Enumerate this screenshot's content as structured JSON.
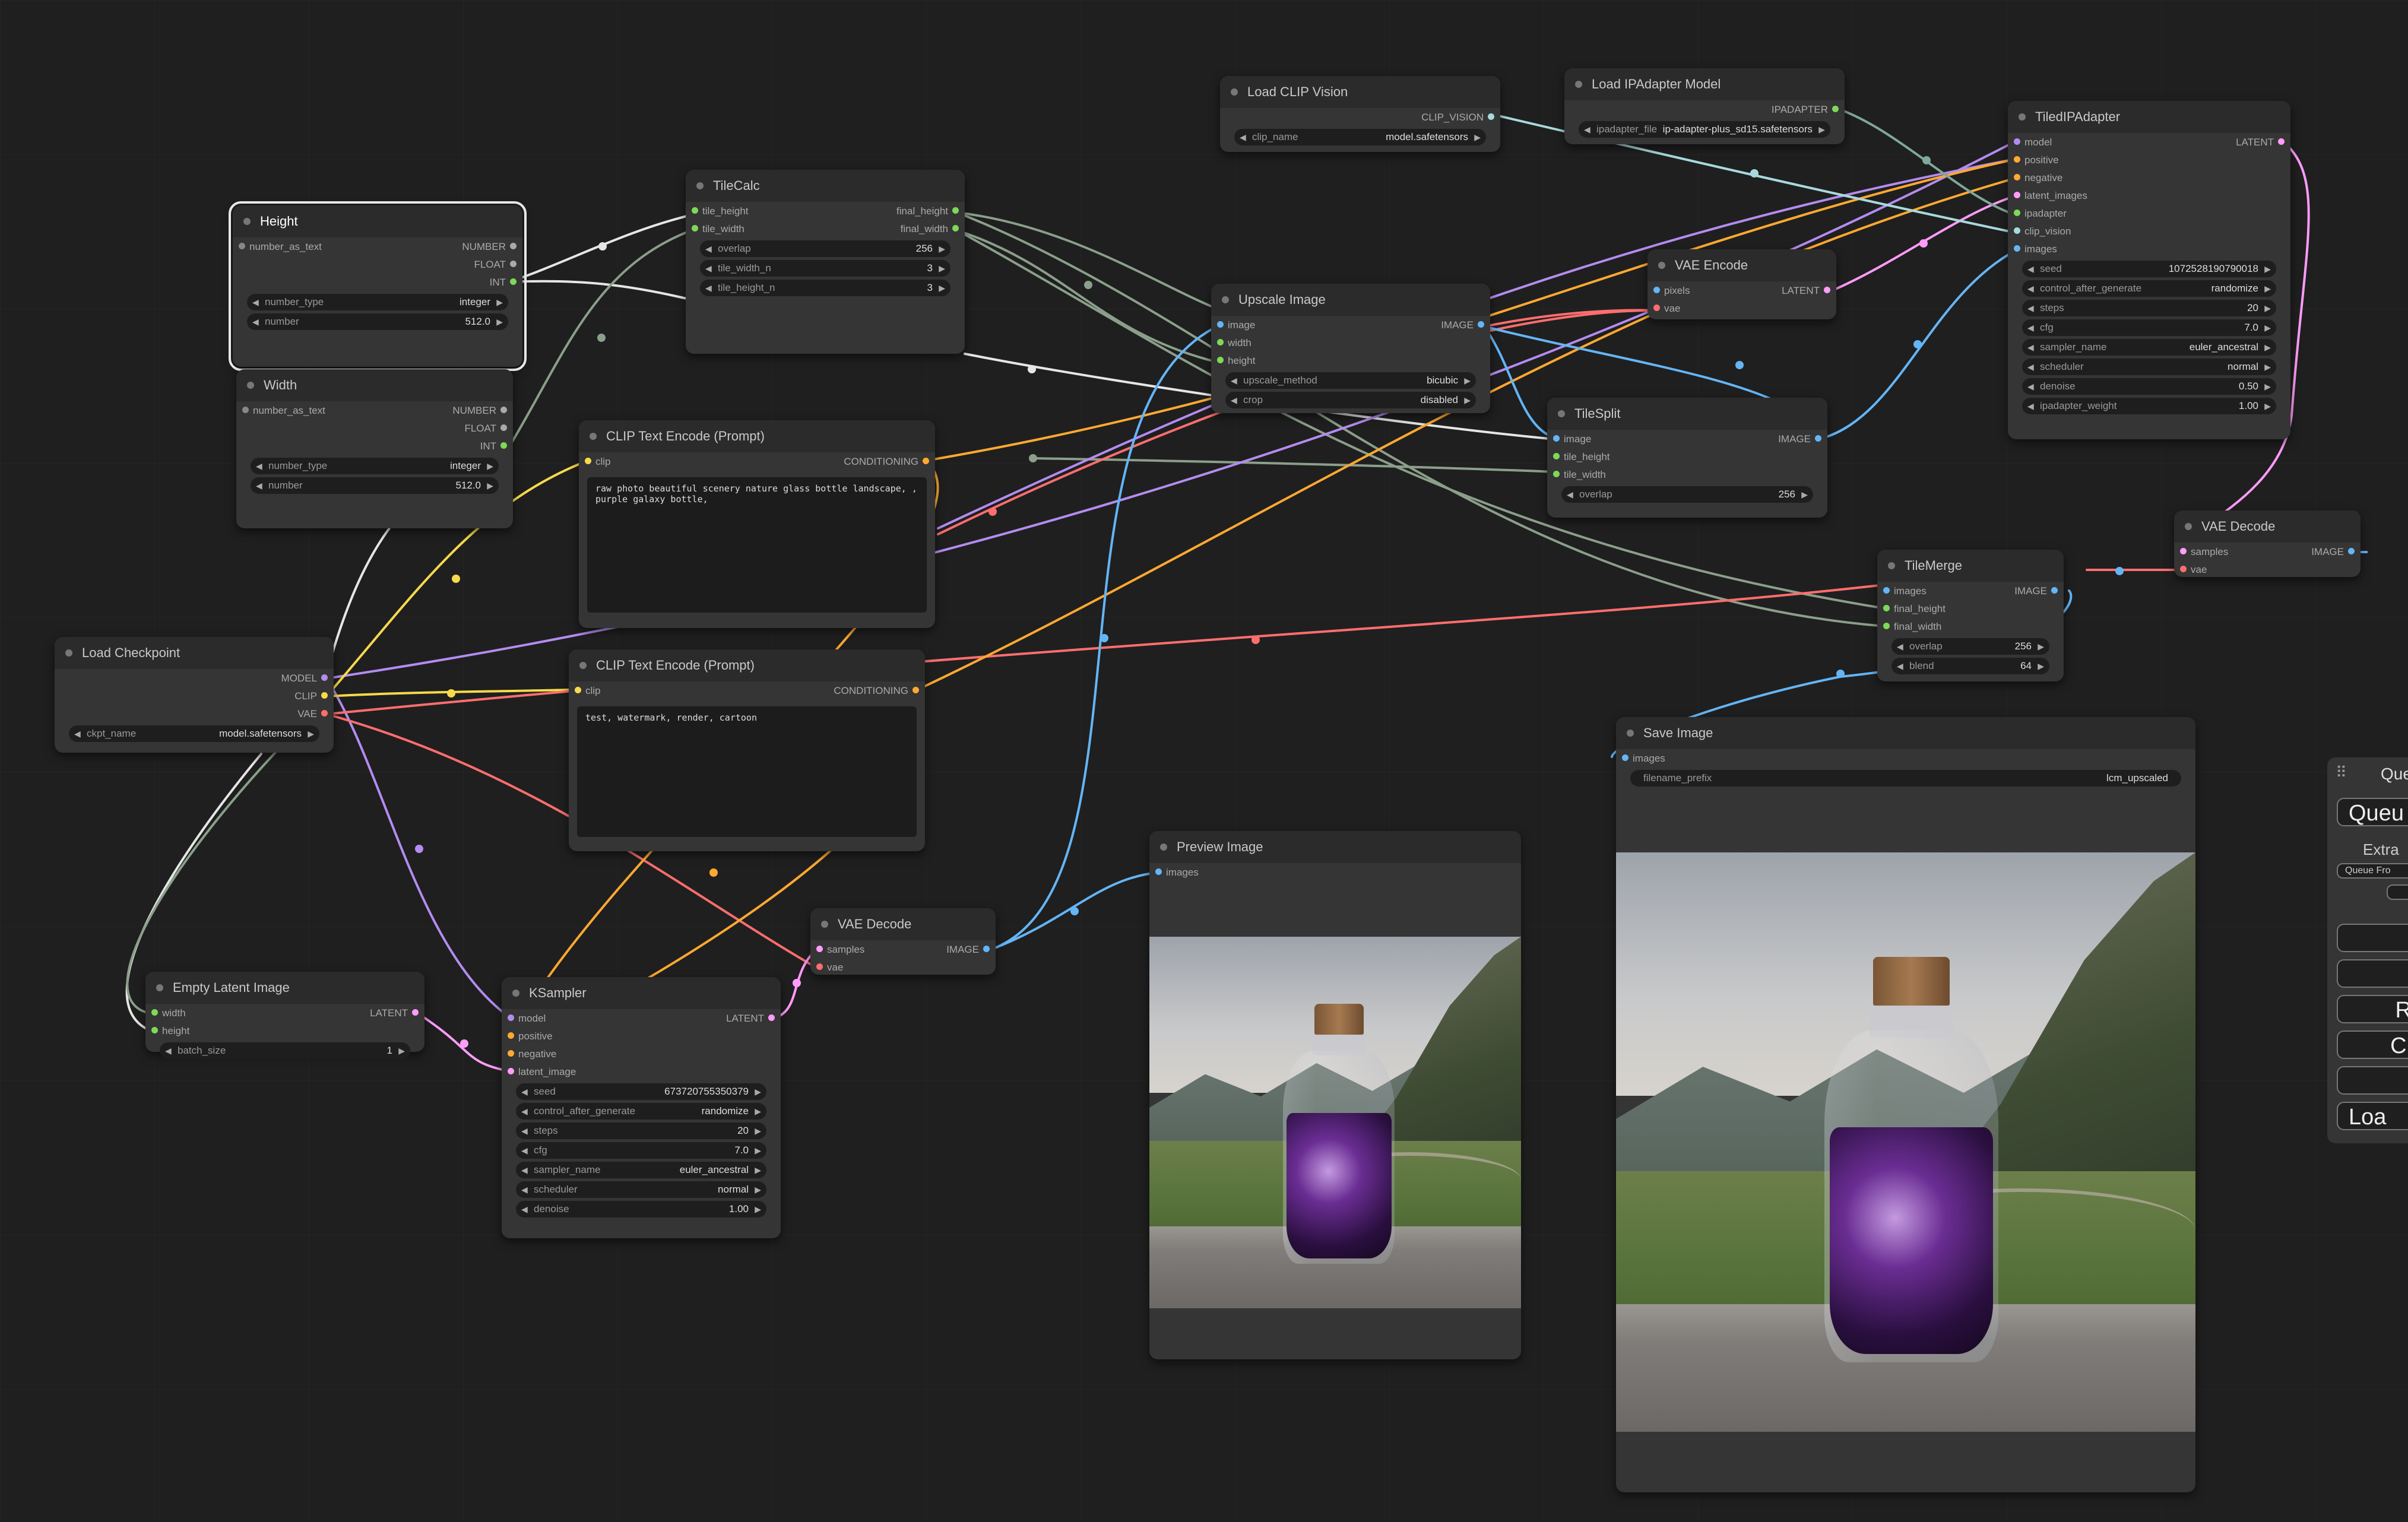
{
  "colors": {
    "model": "#b48cf0",
    "clip": "#f7d94c",
    "vae": "#ff6e6e",
    "latent": "#ff9cf9",
    "image": "#64b5f6",
    "conditioning": "#ffa931",
    "int": "#7ed957",
    "clip_vision": "#a8dadc",
    "ipadapter": "#7ed957",
    "number": "#aaaaaa"
  },
  "nodes": {
    "height": {
      "title": "Height",
      "outputs": [
        "NUMBER",
        "FLOAT",
        "INT"
      ],
      "inputs": [
        "number_as_text"
      ],
      "w_number_type": "number_type",
      "v_number_type": "integer",
      "w_number": "number",
      "v_number": "512.0"
    },
    "width": {
      "title": "Width",
      "outputs": [
        "NUMBER",
        "FLOAT",
        "INT"
      ],
      "inputs": [
        "number_as_text"
      ],
      "w_number_type": "number_type",
      "v_number_type": "integer",
      "w_number": "number",
      "v_number": "512.0"
    },
    "tilecalc": {
      "title": "TileCalc",
      "inputs": [
        "tile_height",
        "tile_width"
      ],
      "outputs": [
        "final_height",
        "final_width"
      ],
      "w_overlap": "overlap",
      "v_overlap": "256",
      "w_tile_width_n": "tile_width_n",
      "v_tile_width_n": "3",
      "w_tile_height_n": "tile_height_n",
      "v_tile_height_n": "3"
    },
    "clip_pos": {
      "title": "CLIP Text Encode (Prompt)",
      "input": "clip",
      "output": "CONDITIONING",
      "text": "raw photo beautiful scenery nature glass bottle landscape, , purple galaxy bottle,"
    },
    "clip_neg": {
      "title": "CLIP Text Encode (Prompt)",
      "input": "clip",
      "output": "CONDITIONING",
      "text": "test, watermark, render, cartoon"
    },
    "load_checkpoint": {
      "title": "Load Checkpoint",
      "outputs": [
        "MODEL",
        "CLIP",
        "VAE"
      ],
      "w_ckpt_name": "ckpt_name",
      "v_ckpt_name": "model.safetensors"
    },
    "empty_latent": {
      "title": "Empty Latent Image",
      "inputs": [
        "width",
        "height"
      ],
      "output": "LATENT",
      "w_batch_size": "batch_size",
      "v_batch_size": "1"
    },
    "ksampler": {
      "title": "KSampler",
      "inputs": [
        "model",
        "positive",
        "negative",
        "latent_image"
      ],
      "output": "LATENT",
      "widgets": [
        {
          "n": "seed",
          "v": "673720755350379"
        },
        {
          "n": "control_after_generate",
          "v": "randomize"
        },
        {
          "n": "steps",
          "v": "20"
        },
        {
          "n": "cfg",
          "v": "7.0"
        },
        {
          "n": "sampler_name",
          "v": "euler_ancestral"
        },
        {
          "n": "scheduler",
          "v": "normal"
        },
        {
          "n": "denoise",
          "v": "1.00"
        }
      ]
    },
    "vae_decode_1": {
      "title": "VAE Decode",
      "inputs": [
        "samples",
        "vae"
      ],
      "output": "IMAGE"
    },
    "preview": {
      "title": "Preview Image",
      "input": "images"
    },
    "load_clip_vision": {
      "title": "Load CLIP Vision",
      "output": "CLIP_VISION",
      "w_clip_name": "clip_name",
      "v_clip_name": "model.safetensors"
    },
    "load_ipadapter": {
      "title": "Load IPAdapter Model",
      "output": "IPADAPTER",
      "w_ipadapter_file": "ipadapter_file",
      "v_ipadapter_file": "ip-adapter-plus_sd15.safetensors"
    },
    "upscale": {
      "title": "Upscale Image",
      "inputs": [
        "image",
        "width",
        "height"
      ],
      "output": "IMAGE",
      "w_upscale_method": "upscale_method",
      "v_upscale_method": "bicubic",
      "w_crop": "crop",
      "v_crop": "disabled"
    },
    "vae_encode": {
      "title": "VAE Encode",
      "inputs": [
        "pixels",
        "vae"
      ],
      "output": "LATENT"
    },
    "tilesplit": {
      "title": "TileSplit",
      "inputs": [
        "image",
        "tile_height",
        "tile_width"
      ],
      "output": "IMAGE",
      "w_overlap": "overlap",
      "v_overlap": "256"
    },
    "tiled_ipadapter": {
      "title": "TiledIPAdapter",
      "inputs": [
        "model",
        "positive",
        "negative",
        "latent_images",
        "ipadapter",
        "clip_vision",
        "images"
      ],
      "output": "LATENT",
      "widgets": [
        {
          "n": "seed",
          "v": "1072528190790018"
        },
        {
          "n": "control_after_generate",
          "v": "randomize"
        },
        {
          "n": "steps",
          "v": "20"
        },
        {
          "n": "cfg",
          "v": "7.0"
        },
        {
          "n": "sampler_name",
          "v": "euler_ancestral"
        },
        {
          "n": "scheduler",
          "v": "normal"
        },
        {
          "n": "denoise",
          "v": "0.50"
        },
        {
          "n": "ipadapter_weight",
          "v": "1.00"
        }
      ]
    },
    "tilemerge": {
      "title": "TileMerge",
      "inputs": [
        "images",
        "final_height",
        "final_width"
      ],
      "output": "IMAGE",
      "w_overlap": "overlap",
      "v_overlap": "256",
      "w_blend": "blend",
      "v_blend": "64"
    },
    "vae_decode_2": {
      "title": "VAE Decode",
      "inputs": [
        "samples",
        "vae"
      ],
      "output": "IMAGE"
    },
    "save": {
      "title": "Save Image",
      "input": "images",
      "w_filename_prefix": "filename_prefix",
      "v_filename_prefix": "lcm_upscaled"
    }
  },
  "side_panel": {
    "title": "Que",
    "queue_button": "Queu",
    "extra": "Extra",
    "queue_front": "Queue Fro",
    "refresh": "R",
    "clear": "Cl",
    "load": "Loa"
  }
}
